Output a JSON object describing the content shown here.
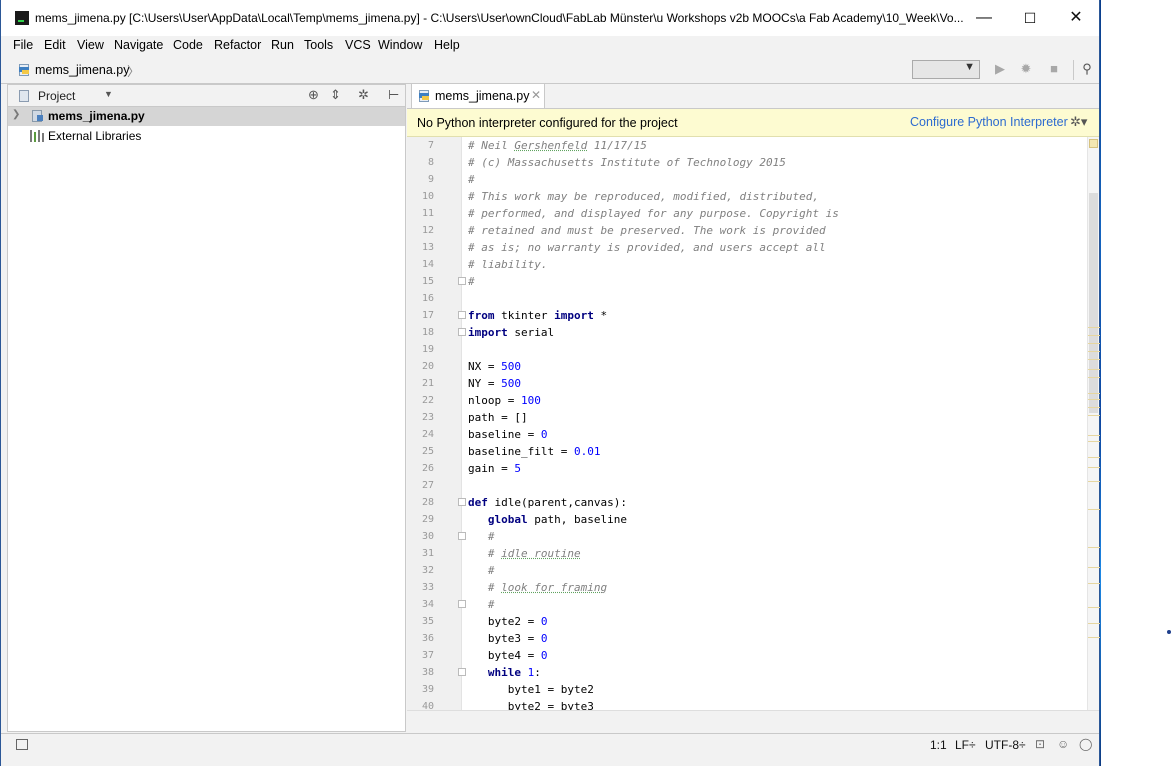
{
  "window": {
    "title": "mems_jimena.py [C:\\Users\\User\\AppData\\Local\\Temp\\mems_jimena.py] - C:\\Users\\User\\ownCloud\\FabLab Münster\\u Workshops v2b MOOCs\\a Fab Academy\\10_Week\\Vo...",
    "minimize": "—",
    "maximize": "☐",
    "close": "✕"
  },
  "menu": [
    "File",
    "Edit",
    "View",
    "Navigate",
    "Code",
    "Refactor",
    "Run",
    "Tools",
    "VCS",
    "Window",
    "Help"
  ],
  "navbar": {
    "breadcrumb": "mems_jimena.py",
    "run_config": ""
  },
  "project_panel": {
    "title": "Project",
    "tree": [
      {
        "label": "mems_jimena.py",
        "selected": true
      },
      {
        "label": "External Libraries",
        "selected": false
      }
    ]
  },
  "editor": {
    "tab_label": "mems_jimena.py",
    "warning_text": "No Python interpreter configured for the project",
    "warning_link": "Configure Python Interpreter",
    "lines": [
      {
        "n": "7",
        "t": "# Neil Gershenfeld 11/17/15",
        "k": "com"
      },
      {
        "n": "8",
        "t": "# (c) Massachusetts Institute of Technology 2015",
        "k": "com"
      },
      {
        "n": "9",
        "t": "#",
        "k": "com"
      },
      {
        "n": "10",
        "t": "# This work may be reproduced, modified, distributed,",
        "k": "com"
      },
      {
        "n": "11",
        "t": "# performed, and displayed for any purpose. Copyright is",
        "k": "com"
      },
      {
        "n": "12",
        "t": "# retained and must be preserved. The work is provided",
        "k": "com"
      },
      {
        "n": "13",
        "t": "# as is; no warranty is provided, and users accept all",
        "k": "com"
      },
      {
        "n": "14",
        "t": "# liability.",
        "k": "com"
      },
      {
        "n": "15",
        "t": "#",
        "k": "com"
      },
      {
        "n": "16",
        "t": "",
        "k": "plain"
      },
      {
        "n": "17",
        "t": "from tkinter import *",
        "k": "code"
      },
      {
        "n": "18",
        "t": "import serial",
        "k": "code"
      },
      {
        "n": "19",
        "t": "",
        "k": "plain"
      },
      {
        "n": "20",
        "t": "NX = 500",
        "k": "code"
      },
      {
        "n": "21",
        "t": "NY = 500",
        "k": "code"
      },
      {
        "n": "22",
        "t": "nloop = 100",
        "k": "code"
      },
      {
        "n": "23",
        "t": "path = []",
        "k": "code"
      },
      {
        "n": "24",
        "t": "baseline = 0",
        "k": "code"
      },
      {
        "n": "25",
        "t": "baseline_filt = 0.01",
        "k": "code"
      },
      {
        "n": "26",
        "t": "gain = 5",
        "k": "code"
      },
      {
        "n": "27",
        "t": "",
        "k": "plain"
      },
      {
        "n": "28",
        "t": "def idle(parent,canvas):",
        "k": "code"
      },
      {
        "n": "29",
        "t": "   global path, baseline",
        "k": "code"
      },
      {
        "n": "30",
        "t": "   #",
        "k": "com"
      },
      {
        "n": "31",
        "t": "   # idle routine",
        "k": "com"
      },
      {
        "n": "32",
        "t": "   #",
        "k": "com"
      },
      {
        "n": "33",
        "t": "   # look for framing",
        "k": "com"
      },
      {
        "n": "34",
        "t": "   #",
        "k": "com"
      },
      {
        "n": "35",
        "t": "   byte2 = 0",
        "k": "code"
      },
      {
        "n": "36",
        "t": "   byte3 = 0",
        "k": "code"
      },
      {
        "n": "37",
        "t": "   byte4 = 0",
        "k": "code"
      },
      {
        "n": "38",
        "t": "   while 1:",
        "k": "code"
      },
      {
        "n": "39",
        "t": "      byte1 = byte2",
        "k": "code"
      },
      {
        "n": "40",
        "t": "      byte2 = byte3",
        "k": "code"
      }
    ]
  },
  "statusbar": {
    "position": "1:1",
    "line_sep": "LF÷",
    "encoding": "UTF-8÷"
  }
}
